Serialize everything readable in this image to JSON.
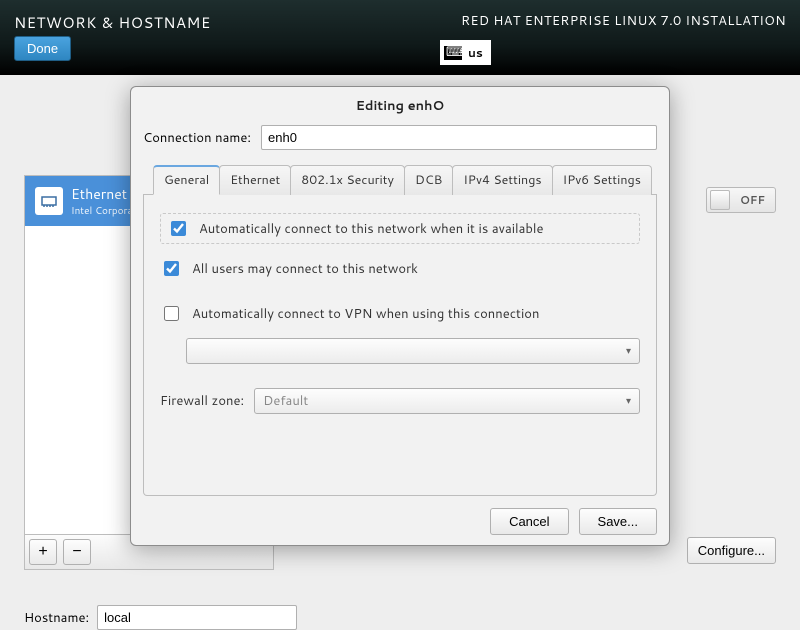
{
  "header": {
    "title": "NETWORK & HOSTNAME",
    "product": "RED HAT ENTERPRISE LINUX 7.0 INSTALLATION",
    "done_label": "Done",
    "keyboard_layout": "us"
  },
  "sidebar": {
    "interfaces": [
      {
        "name": "Ethernet",
        "subtitle": "Intel Corporation"
      }
    ],
    "add_label": "+",
    "remove_label": "−"
  },
  "toggle": {
    "state_label": "OFF"
  },
  "configure_label": "Configure...",
  "hostname": {
    "label": "Hostname:",
    "value": "local"
  },
  "dialog": {
    "title": "Editing enhO",
    "connection_name_label": "Connection name:",
    "connection_name_value": "enh0",
    "tabs": [
      "General",
      "Ethernet",
      "802.1x Security",
      "DCB",
      "IPv4 Settings",
      "IPv6 Settings"
    ],
    "active_tab": 0,
    "general": {
      "auto_connect_label": "Automatically connect to this network when it is available",
      "auto_connect_checked": true,
      "all_users_label": "All users may connect to this network",
      "all_users_checked": true,
      "auto_vpn_label": "Automatically connect to VPN when using this connection",
      "auto_vpn_checked": false,
      "vpn_combo_value": "",
      "firewall_label": "Firewall zone:",
      "firewall_value": "Default"
    },
    "cancel_label": "Cancel",
    "save_label": "Save..."
  }
}
